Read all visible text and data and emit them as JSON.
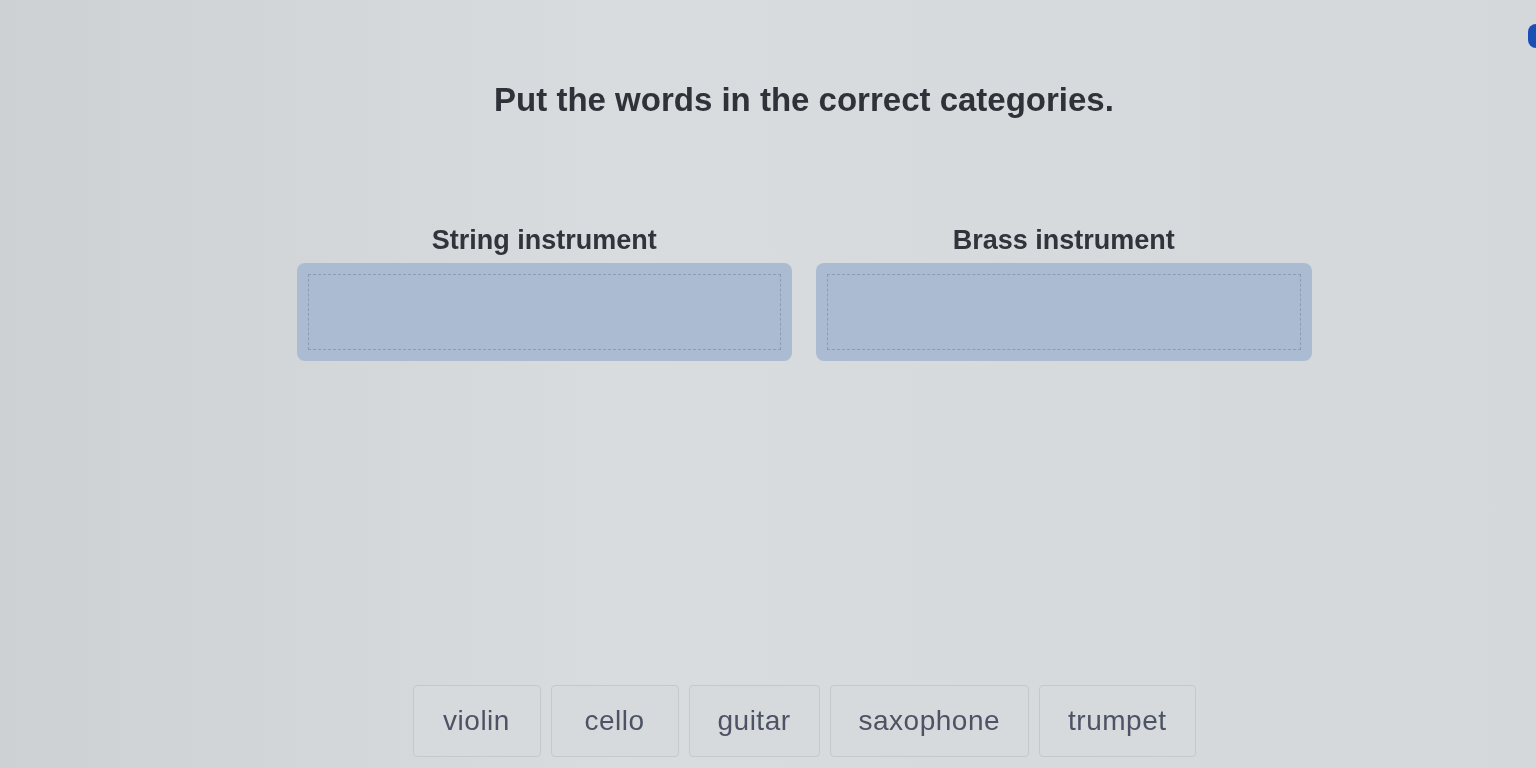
{
  "instruction": "Put the words in the correct categories.",
  "categories": [
    {
      "label": "String instrument"
    },
    {
      "label": "Brass instrument"
    }
  ],
  "words": [
    "violin",
    "cello",
    "guitar",
    "saxophone",
    "trumpet"
  ]
}
